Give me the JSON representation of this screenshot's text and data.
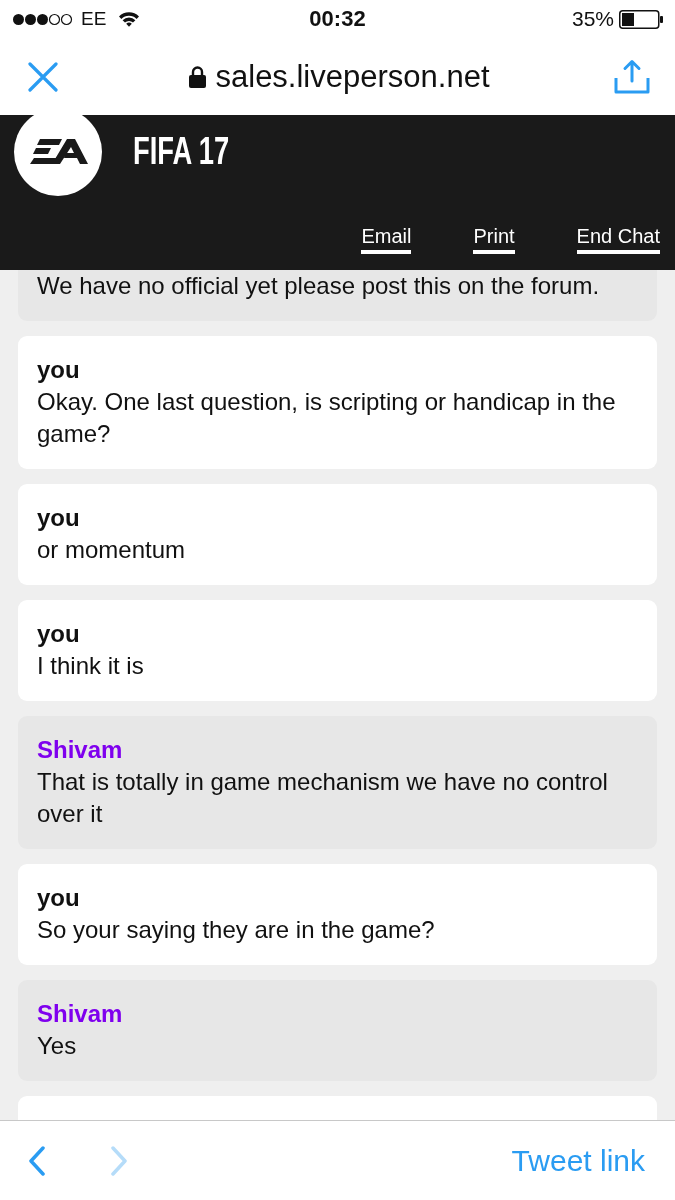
{
  "status_bar": {
    "carrier": "EE",
    "time": "00:32",
    "battery": "35%"
  },
  "browser": {
    "url": "sales.liveperson.net"
  },
  "header": {
    "title": "FIFA 17",
    "links": [
      "Email",
      "Print",
      "End Chat"
    ]
  },
  "messages": [
    {
      "highlighted": true,
      "text": "We have no official yet please post this on the forum."
    },
    {
      "highlighted": false,
      "sender": "you",
      "text": "Okay. One last question, is scripting or handicap in the game?"
    },
    {
      "highlighted": false,
      "sender": "you",
      "text": "or momentum"
    },
    {
      "highlighted": false,
      "sender": "you",
      "text": "I think it is"
    },
    {
      "highlighted": true,
      "sender": "Shivam",
      "text": "That is totally in game mechanism we have no control over it"
    },
    {
      "highlighted": false,
      "sender": "you",
      "text": "So your saying they are in the game?"
    },
    {
      "highlighted": true,
      "sender": "Shivam",
      "text": "Yes"
    },
    {
      "highlighted": false
    }
  ],
  "toolbar": {
    "back": {
      "disabled": false
    },
    "forward": {
      "disabled": true
    },
    "action": "Tweet link"
  }
}
